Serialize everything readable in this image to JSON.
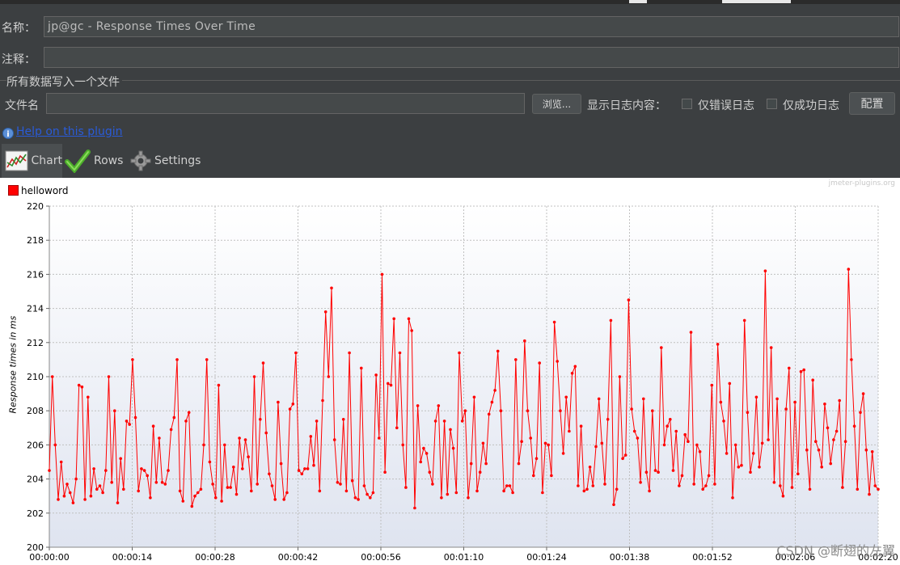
{
  "form": {
    "name_label": "名称：",
    "name_value": "jp@gc - Response Times Over Time",
    "comment_label": "注释：",
    "comment_value": "",
    "section_title": "所有数据写入一个文件",
    "filename_label": "文件名",
    "filename_value": "",
    "browse_label": "浏览...",
    "log_label": "显示日志内容：",
    "errors_only_label": "仅错误日志",
    "success_only_label": "仅成功日志",
    "configure_label": "配置",
    "help_link": "Help on this plugin"
  },
  "tabs": [
    {
      "label": "Chart",
      "icon": "chart-icon",
      "selected": true
    },
    {
      "label": "Rows",
      "icon": "checkmark-icon",
      "selected": false
    },
    {
      "label": "Settings",
      "icon": "gear-icon",
      "selected": false
    }
  ],
  "chart": {
    "brand": "jmeter-plugins.org",
    "watermark": "CSDN @断翅的左翼"
  },
  "chart_data": {
    "type": "line",
    "title": "",
    "ylabel": "Response times in ms",
    "xlabel": "",
    "ylim": [
      200,
      220
    ],
    "yticks": [
      200,
      202,
      204,
      206,
      208,
      210,
      212,
      214,
      216,
      218,
      220
    ],
    "xlim_seconds": [
      0,
      140
    ],
    "xticks": [
      "00:00:00",
      "00:00:14",
      "00:00:28",
      "00:00:42",
      "00:00:56",
      "00:01:10",
      "00:01:24",
      "00:01:38",
      "00:01:52",
      "00:02:06",
      "00:02:20"
    ],
    "grid": true,
    "legend": "top-left",
    "color": "#ff0000",
    "series": [
      {
        "name": "helloword",
        "values": [
          204.5,
          210,
          206,
          202.8,
          205,
          203,
          203.7,
          203.2,
          202.6,
          204,
          209.5,
          209.4,
          202.8,
          208.8,
          203,
          204.6,
          203.4,
          203.6,
          203.2,
          204.5,
          210,
          203.8,
          208,
          202.6,
          205.2,
          203.4,
          207.4,
          207.2,
          211,
          207.6,
          203.3,
          204.6,
          204.5,
          204.2,
          202.9,
          207.1,
          203.8,
          206.4,
          203.8,
          203.7,
          204.5,
          206.9,
          207.6,
          211,
          203.3,
          202.7,
          207.4,
          207.9,
          202.4,
          203,
          203.2,
          203.4,
          206,
          211,
          205,
          203.7,
          202.9,
          209.5,
          202.7,
          206,
          203.5,
          203.5,
          204.7,
          203.1,
          206.4,
          204.6,
          206.3,
          205.3,
          203.3,
          210,
          203.7,
          207.5,
          210.8,
          206.7,
          204.3,
          203.6,
          202.8,
          208.5,
          204.9,
          202.8,
          203.2,
          208.1,
          208.4,
          211.4,
          204.5,
          204.3,
          204.6,
          204.6,
          206.5,
          204.8,
          207.4,
          203.3,
          208.6,
          213.8,
          210,
          215.2,
          206.3,
          203.8,
          203.7,
          207.5,
          203.3,
          211.4,
          203.9,
          202.9,
          202.8,
          210.5,
          203.6,
          203.1,
          202.9,
          203.2,
          210.1,
          206.4,
          216,
          204.4,
          209.6,
          209.5,
          213.4,
          207,
          211.4,
          206,
          203.5,
          213.4,
          212.7,
          202.3,
          208.3,
          205,
          205.8,
          205.5,
          204.4,
          203.7,
          207.4,
          208.3,
          202.9,
          207.4,
          203.1,
          206.9,
          205.8,
          203.2,
          211.4,
          207.4,
          208,
          202.9,
          204.9,
          208.8,
          203.3,
          204.4,
          206.1,
          204.9,
          207.8,
          208.5,
          209.2,
          211.5,
          208,
          203.3,
          203.6,
          203.6,
          203.2,
          211,
          204.9,
          206.2,
          212.1,
          208,
          206.4,
          204.2,
          205.2,
          210.8,
          203.2,
          206.1,
          206,
          204.2,
          213.2,
          210.9,
          208,
          205.5,
          208.8,
          206.8,
          210.2,
          210.6,
          203.6,
          207.1,
          203.3,
          203.4,
          204.7,
          203.6,
          205.9,
          208.7,
          206.1,
          203.7,
          207.5,
          213.3,
          202.5,
          203.4,
          210,
          205.2,
          205.4,
          214.5,
          208.1,
          206.8,
          206.4,
          203.8,
          208.7,
          204.4,
          203.3,
          208,
          204.5,
          204.4,
          211.7,
          206,
          207.1,
          207.5,
          204.5,
          206.8,
          203.6,
          204.2,
          206.6,
          206.2,
          212.6,
          203.7,
          206,
          205.6,
          203.4,
          203.6,
          204.2,
          209.5,
          203.7,
          211.9,
          208.5,
          207.4,
          205.5,
          209.6,
          202.9,
          206,
          204.7,
          204.8,
          213.3,
          207.9,
          204.4,
          205.5,
          208.8,
          204.7,
          206.1,
          216.2,
          206.3,
          211.7,
          203.8,
          208.7,
          203.6,
          203,
          208.1,
          210.5,
          203.5,
          208.5,
          204.3,
          210.3,
          210.4,
          205.7,
          203.4,
          209.8,
          206.2,
          205.7,
          204.7,
          208.4,
          207,
          204.9,
          206.3,
          206.8,
          208.6,
          203.5,
          206.2,
          216.3,
          211,
          207.1,
          203.4,
          207.9,
          209,
          205.7,
          203.1,
          205.6,
          203.6,
          203.4
        ]
      }
    ]
  }
}
